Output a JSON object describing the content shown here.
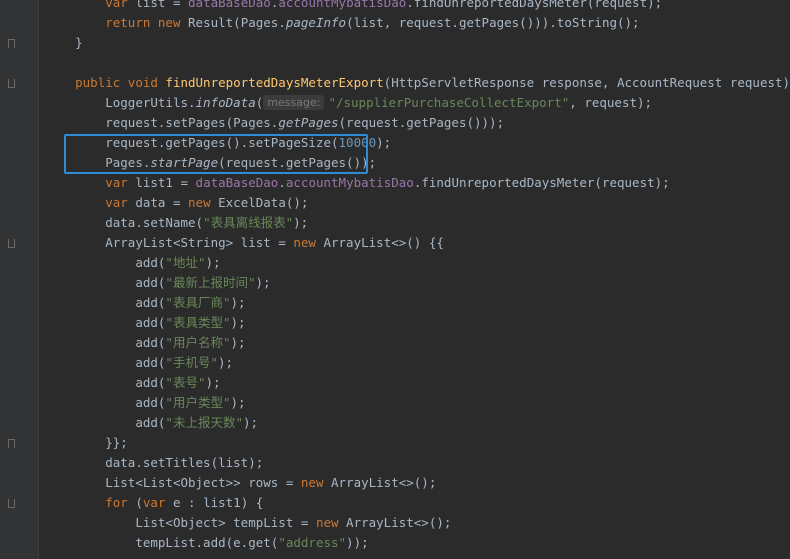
{
  "code": {
    "l0_a": "var ",
    "l0_b": "list = ",
    "l0_c": "dataBaseDao",
    "l0_d": ".",
    "l0_e": "accountMybatisDao",
    "l0_f": ".findUnreportedDaysMeter(request);",
    "l1_a": "return new ",
    "l1_b": "Result(Pages.",
    "l1_c": "pageInfo",
    "l1_d": "(list, request.getPages())).toString();",
    "l2": "}",
    "l4_a": "public void ",
    "l4_b": "findUnreportedDaysMeterExport",
    "l4_c": "(HttpServletResponse response, AccountRequest request) {",
    "l5_a": "LoggerUtils.",
    "l5_b": "infoData",
    "l5_c": "(",
    "l5_hint": "message:",
    "l5_d": "\"/supplierPurchaseCollectExport\"",
    "l5_e": ", request);",
    "l6_a": "request.setPages(Pages.",
    "l6_b": "getPages",
    "l6_c": "(request.getPages()));",
    "l7_a": "request.getPages().setPageSize(",
    "l7_b": "10000",
    "l7_c": ");",
    "l8_a": "Pages.",
    "l8_b": "startPage",
    "l8_c": "(request.getPages());",
    "l9_a": "var ",
    "l9_b": "list1 = ",
    "l9_c": "dataBaseDao",
    "l9_d": ".",
    "l9_e": "accountMybatisDao",
    "l9_f": ".findUnreportedDaysMeter(request);",
    "l10_a": "var ",
    "l10_b": "data = ",
    "l10_c": "new ",
    "l10_d": "ExcelData();",
    "l11_a": "data.setName(",
    "l11_b": "\"表具离线报表\"",
    "l11_c": ");",
    "l12_a": "ArrayList<String> list = ",
    "l12_b": "new ",
    "l12_c": "ArrayList<>() {{",
    "adds": [
      "\"地址\"",
      "\"最新上报时间\"",
      "\"表具厂商\"",
      "\"表具类型\"",
      "\"用户名称\"",
      "\"手机号\"",
      "\"表号\"",
      "\"用户类型\"",
      "\"未上报天数\""
    ],
    "add_open": "add(",
    "add_close": ");",
    "l22": "}};",
    "l23": "data.setTitles(list);",
    "l24_a": "List<List<Object>> rows = ",
    "l24_b": "new ",
    "l24_c": "ArrayList<>();",
    "l25_a": "for ",
    "l25_b": "(",
    "l25_c": "var ",
    "l25_d": "e : list1) {",
    "l26_a": "List<Object> tempList = ",
    "l26_b": "new ",
    "l26_c": "ArrayList<>();",
    "l27_a": "tempList.add(e.get(",
    "l27_b": "\"address\"",
    "l27_c": "));"
  },
  "colors": {
    "background": "#2b2b2b",
    "keyword": "#cc7832",
    "method": "#ffc66d",
    "field": "#9876aa",
    "string": "#6a8759",
    "number": "#6897bb",
    "highlight_border": "#2e8bd6"
  }
}
